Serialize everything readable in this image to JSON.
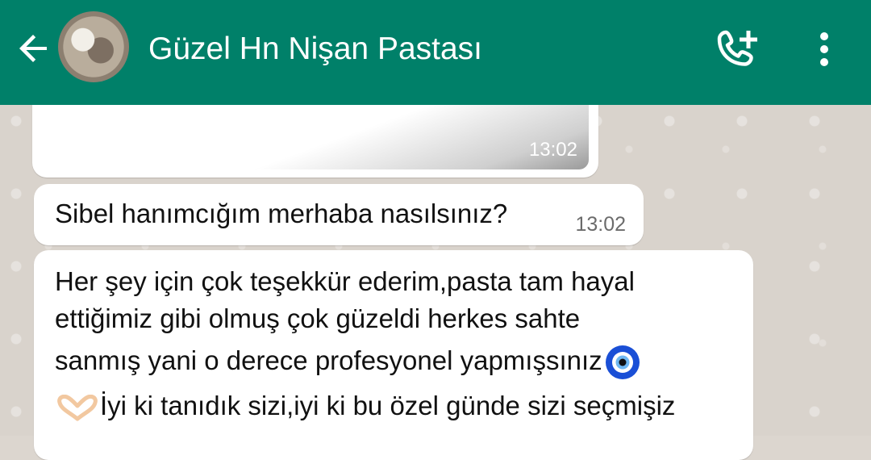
{
  "header": {
    "title": "Güzel Hn Nişan Pastası",
    "color": "#008069"
  },
  "messages": [
    {
      "type": "image",
      "time": "13:02"
    },
    {
      "type": "text",
      "text": "Sibel hanımcığım merhaba nasılsınız?",
      "time": "13:02"
    },
    {
      "type": "text",
      "lines": [
        "Her şey için çok teşekkür ederim,pasta tam hayal",
        "ettiğimiz gibi olmuş çok güzeldi herkes sahte",
        "sanmış yani o derece profesyonel yapmışsınız",
        "İyi ki tanıdık sizi,iyi ki bu özel günde sizi seçmişiz"
      ],
      "emoji": [
        "nazar-boncugu-icon",
        "heart-hands-icon"
      ]
    }
  ],
  "icons": [
    "back-arrow-icon",
    "add-call-icon",
    "more-vertical-icon"
  ]
}
